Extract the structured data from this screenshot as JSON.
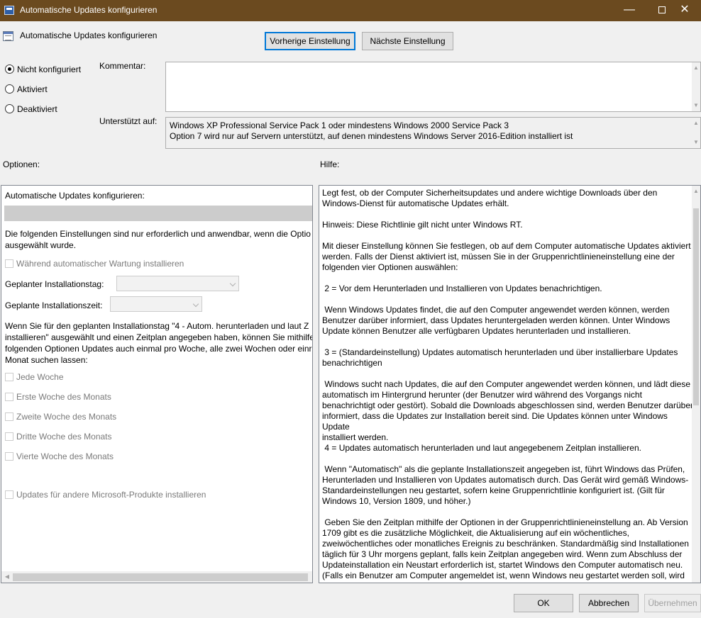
{
  "window": {
    "title": "Automatische Updates konfigurieren",
    "minimize": "—",
    "close": "✕"
  },
  "policy_title": "Automatische Updates konfigurieren",
  "nav": {
    "previous": "Vorherige Einstellung",
    "next": "Nächste Einstellung"
  },
  "state": {
    "options": [
      "Nicht konfiguriert",
      "Aktiviert",
      "Deaktiviert"
    ],
    "selected": "Nicht konfiguriert"
  },
  "comment": {
    "label": "Kommentar:",
    "value": ""
  },
  "supported": {
    "label": "Unterstützt auf:",
    "lines": [
      "Windows XP Professional Service Pack 1 oder mindestens Windows 2000 Service Pack 3",
      "Option 7 wird nur auf Servern unterstützt, auf denen mindestens Windows Server 2016-Edition installiert ist"
    ]
  },
  "options": {
    "header": "Optionen:",
    "configure_label": "Automatische Updates konfigurieren:",
    "note_lines": [
      "Die folgenden Einstellungen sind nur erforderlich und anwendbar, wenn die Optio",
      "ausgewählt wurde."
    ],
    "maintenance": "Während automatischer Wartung installieren",
    "day_label": "Geplanter Installationstag:",
    "time_label": "Geplante Installationszeit:",
    "schedule_lines": [
      "Wenn Sie für den geplanten Installationstag \"4 - Autom. herunterladen und laut Z",
      "installieren\" ausgewählt und einen Zeitplan angegeben haben, können Sie mithilfe",
      "folgenden Optionen Updates auch einmal pro Woche, alle zwei Wochen oder einr",
      "Monat suchen lassen:"
    ],
    "weeks": [
      "Jede Woche",
      "Erste Woche des Monats",
      "Zweite Woche des Monats",
      "Dritte Woche des Monats",
      "Vierte Woche des Monats"
    ],
    "other_products": "Updates für andere Microsoft-Produkte installieren"
  },
  "help": {
    "header": "Hilfe:",
    "paragraphs": [
      "Legt fest, ob der Computer Sicherheitsupdates und andere wichtige Downloads über den\nWindows-Dienst für automatische Updates erhält.",
      "Hinweis: Diese Richtlinie gilt nicht unter Windows RT.",
      "Mit dieser Einstellung können Sie festlegen, ob auf dem Computer automatische Updates aktiviert\nwerden. Falls der Dienst aktiviert ist, müssen Sie in der Gruppenrichtlinieneinstellung eine der\nfolgenden vier Optionen auswählen:",
      " 2 = Vor dem Herunterladen und Installieren von Updates benachrichtigen.",
      " Wenn Windows Updates findet, die auf den Computer angewendet werden können, werden\nBenutzer darüber informiert, dass Updates heruntergeladen werden können. Unter Windows\nUpdate können Benutzer alle verfügbaren Updates herunterladen und installieren.",
      " 3 = (Standardeinstellung) Updates automatisch herunterladen und über installierbare Updates\nbenachrichtigen",
      " Windows sucht nach Updates, die auf den Computer angewendet werden können, und lädt diese\nautomatisch im Hintergrund herunter (der Benutzer wird während des Vorgangs nicht\nbenachrichtigt oder gestört). Sobald die Downloads abgeschlossen sind, werden Benutzer darüber\ninformiert, dass die Updates zur Installation bereit sind. Die Updates können unter Windows Update\ninstalliert werden.",
      " 4 = Updates automatisch herunterladen und laut angegebenem Zeitplan installieren.",
      " Wenn \"Automatisch\" als die geplante Installationszeit angegeben ist, führt Windows das Prüfen,\nHerunterladen und Installieren von Updates automatisch durch. Das Gerät wird gemäß Windows-\nStandardeinstellungen neu gestartet, sofern keine Gruppenrichtlinie konfiguriert ist. (Gilt für\nWindows 10, Version 1809, und höher.)",
      " Geben Sie den Zeitplan mithilfe der Optionen in der Gruppenrichtlinieneinstellung an. Ab Version\n1709 gibt es die zusätzliche Möglichkeit, die Aktualisierung auf ein wöchentliches,\nzweiwöchentliches oder monatliches Ereignis zu beschränken. Standardmäßig sind Installationen\ntäglich für 3 Uhr morgens geplant, falls kein Zeitplan angegeben wird. Wenn zum Abschluss der\nUpdateinstallation ein Neustart erforderlich ist, startet Windows den Computer automatisch neu.\n(Falls ein Benutzer am Computer angemeldet ist, wenn Windows neu gestartet werden soll, wird"
    ]
  },
  "footer": {
    "ok": "OK",
    "cancel": "Abbrechen",
    "apply": "Übernehmen"
  }
}
